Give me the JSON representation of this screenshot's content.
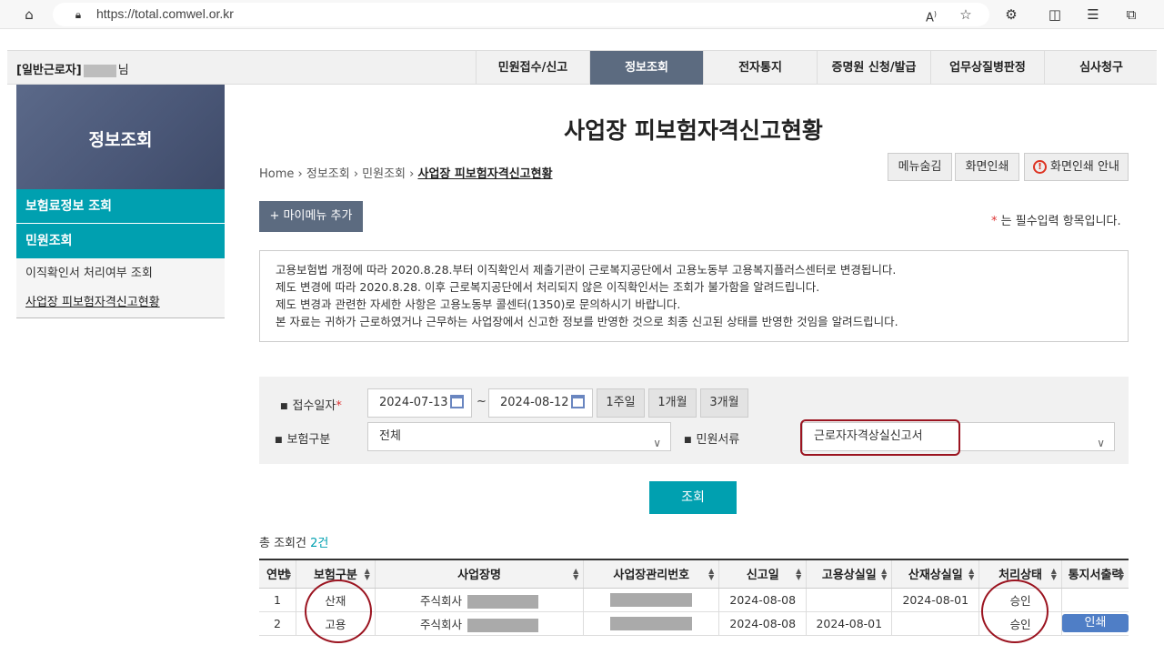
{
  "browser": {
    "url": "https://total.comwel.or.kr"
  },
  "header": {
    "user_prefix": "[일반근로자]",
    "user_suffix": "님",
    "menu": [
      "민원접수/신고",
      "정보조회",
      "전자통지",
      "증명원 신청/발급",
      "업무상질병판정",
      "심사청구"
    ]
  },
  "sidebar": {
    "title": "정보조회",
    "items": [
      "보험료정보 조회",
      "민원조회",
      "이직확인서 처리여부 조회",
      "사업장 피보험자격신고현황"
    ]
  },
  "page": {
    "title": "사업장 피보험자격신고현황",
    "breadcrumb": [
      "Home",
      "정보조회",
      "민원조회",
      "사업장 피보험자격신고현황"
    ],
    "tools": [
      "메뉴숨김",
      "화면인쇄",
      "화면인쇄 안내"
    ],
    "mymenu": "+ 마이메뉴 추가",
    "required_note": "는 필수입력 항목입니다.",
    "notice": [
      "고용보험법 개정에 따라 2020.8.28.부터 이직확인서 제출기관이 근로복지공단에서 고용노동부 고용복지플러스센터로 변경됩니다.",
      "제도 변경에 따라 2020.8.28. 이후 근로복지공단에서 처리되지 않은 이직확인서는 조회가 불가함을 알려드립니다.",
      "제도 변경과 관련한 자세한 사항은 고용노동부 콜센터(1350)로 문의하시기 바랍니다.",
      "본 자료는 귀하가 근로하였거나 근무하는 사업장에서 신고한 정보를 반영한 것으로 최종 신고된 상태를 반영한 것임을 알려드립니다."
    ]
  },
  "search": {
    "date_label": "접수일자",
    "date_from": "2024-07-13",
    "date_to": "2024-08-12",
    "tilde": "~",
    "periods": [
      "1주일",
      "1개월",
      "3개월"
    ],
    "insurance_label": "보험구분",
    "insurance_value": "전체",
    "doc_label": "민원서류",
    "doc_value": "근로자자격상실신고서",
    "submit": "조회"
  },
  "results": {
    "total_label": "총 조회건",
    "total_count": "2건",
    "columns": [
      "연번",
      "보험구분",
      "사업장명",
      "사업장관리번호",
      "신고일",
      "고용상실일",
      "산재상실일",
      "처리상태",
      "통지서출력"
    ],
    "rows": [
      {
        "no": "1",
        "type": "산재",
        "company": "주식회사",
        "report_date": "2024-08-08",
        "emp_loss": "",
        "ind_loss": "2024-08-01",
        "status": "승인",
        "print": ""
      },
      {
        "no": "2",
        "type": "고용",
        "company": "주식회사",
        "report_date": "2024-08-08",
        "emp_loss": "2024-08-01",
        "ind_loss": "",
        "status": "승인",
        "print": "인쇄"
      }
    ]
  },
  "colors": {
    "accent": "#00a0b0",
    "nav_active": "#5c6b80",
    "highlight": "#9b1420"
  }
}
